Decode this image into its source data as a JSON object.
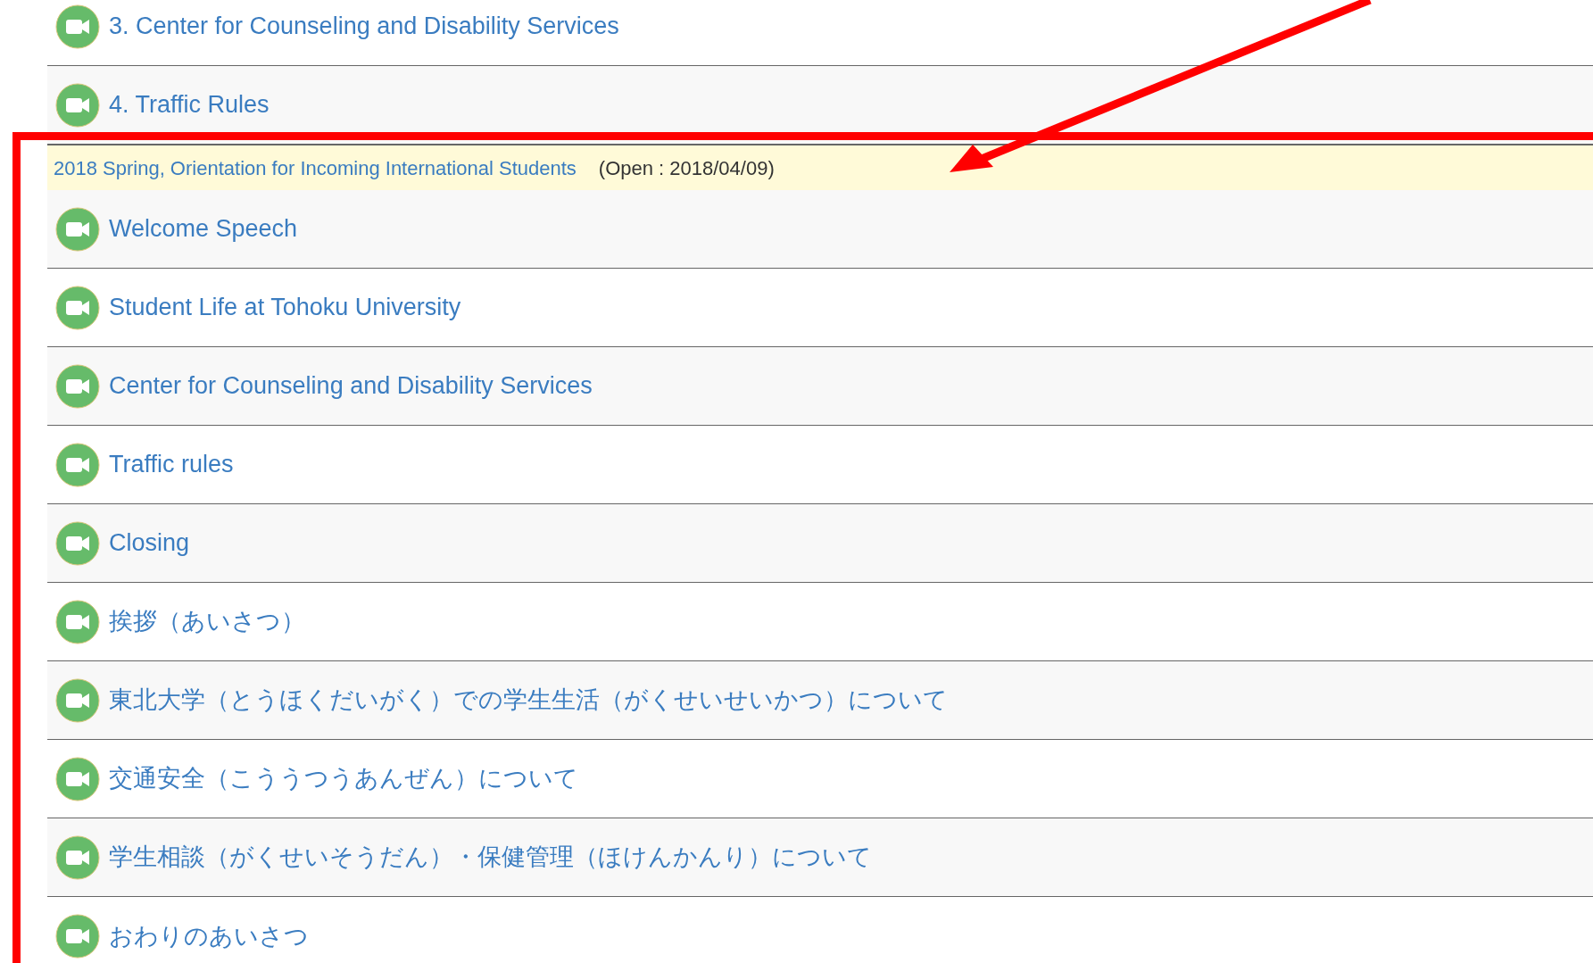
{
  "items": [
    {
      "title": "3. Center for Counseling and Disability Services"
    },
    {
      "title": "4. Traffic Rules"
    }
  ],
  "section": {
    "title": "2018 Spring, Orientation for Incoming International Students",
    "open": "(Open : 2018/04/09)",
    "items": [
      {
        "title": "Welcome Speech"
      },
      {
        "title": "Student Life at Tohoku University"
      },
      {
        "title": "Center for Counseling and Disability Services"
      },
      {
        "title": "Traffic rules"
      },
      {
        "title": "Closing"
      },
      {
        "title": "挨拶（あいさつ）"
      },
      {
        "title": "東北大学（とうほくだいがく）での学生生活（がくせいせいかつ）について"
      },
      {
        "title": "交通安全（こううつうあんぜん）について"
      },
      {
        "title": "学生相談（がくせいそうだん）・保健管理（ほけんかんり）について"
      },
      {
        "title": "おわりのあいさつ"
      }
    ]
  }
}
